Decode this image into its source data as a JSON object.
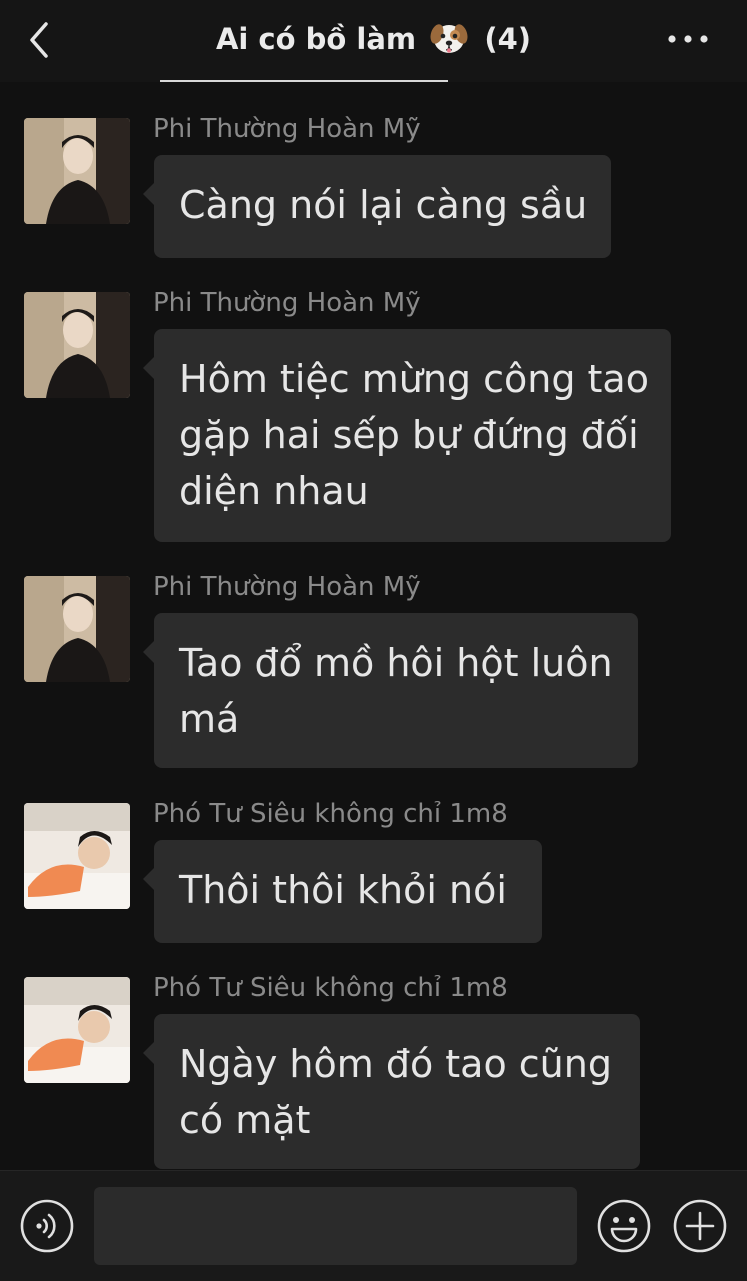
{
  "header": {
    "title": "Ai có bồ làm",
    "member_count": "(4)",
    "back_icon": "chevron-left-icon",
    "more_icon": "more-dots-icon",
    "title_emoji": "dog-face-emoji"
  },
  "messages": [
    {
      "sender": "Phi Thường Hoàn Mỹ",
      "avatar": "avatar-phi-thuong-hoan-my",
      "lines": [
        "Càng nói lại càng sầu"
      ]
    },
    {
      "sender": "Phi Thường Hoàn Mỹ",
      "avatar": "avatar-phi-thuong-hoan-my",
      "lines": [
        "Hôm tiệc mừng công tao",
        "gặp hai sếp bự đứng đối",
        "diện nhau"
      ]
    },
    {
      "sender": "Phi Thường Hoàn Mỹ",
      "avatar": "avatar-phi-thuong-hoan-my",
      "lines": [
        "Tao đổ mồ hôi hột luôn",
        "má"
      ]
    },
    {
      "sender": "Phó Tư Siêu không chỉ 1m8",
      "avatar": "avatar-pho-tu-sieu",
      "lines": [
        "Thôi thôi khỏi nói"
      ]
    },
    {
      "sender": "Phó Tư Siêu không chỉ 1m8",
      "avatar": "avatar-pho-tu-sieu",
      "lines": [
        "Ngày hôm đó tao cũng",
        "có mặt"
      ]
    }
  ],
  "input_bar": {
    "voice_icon": "voice-icon",
    "text_value": "",
    "emoji_icon": "emoji-icon",
    "plus_icon": "plus-icon"
  },
  "colors": {
    "background": "#111111",
    "bubble": "#2c2c2c",
    "sender_text": "#8a8a8a",
    "message_text": "#e6e6e6"
  }
}
